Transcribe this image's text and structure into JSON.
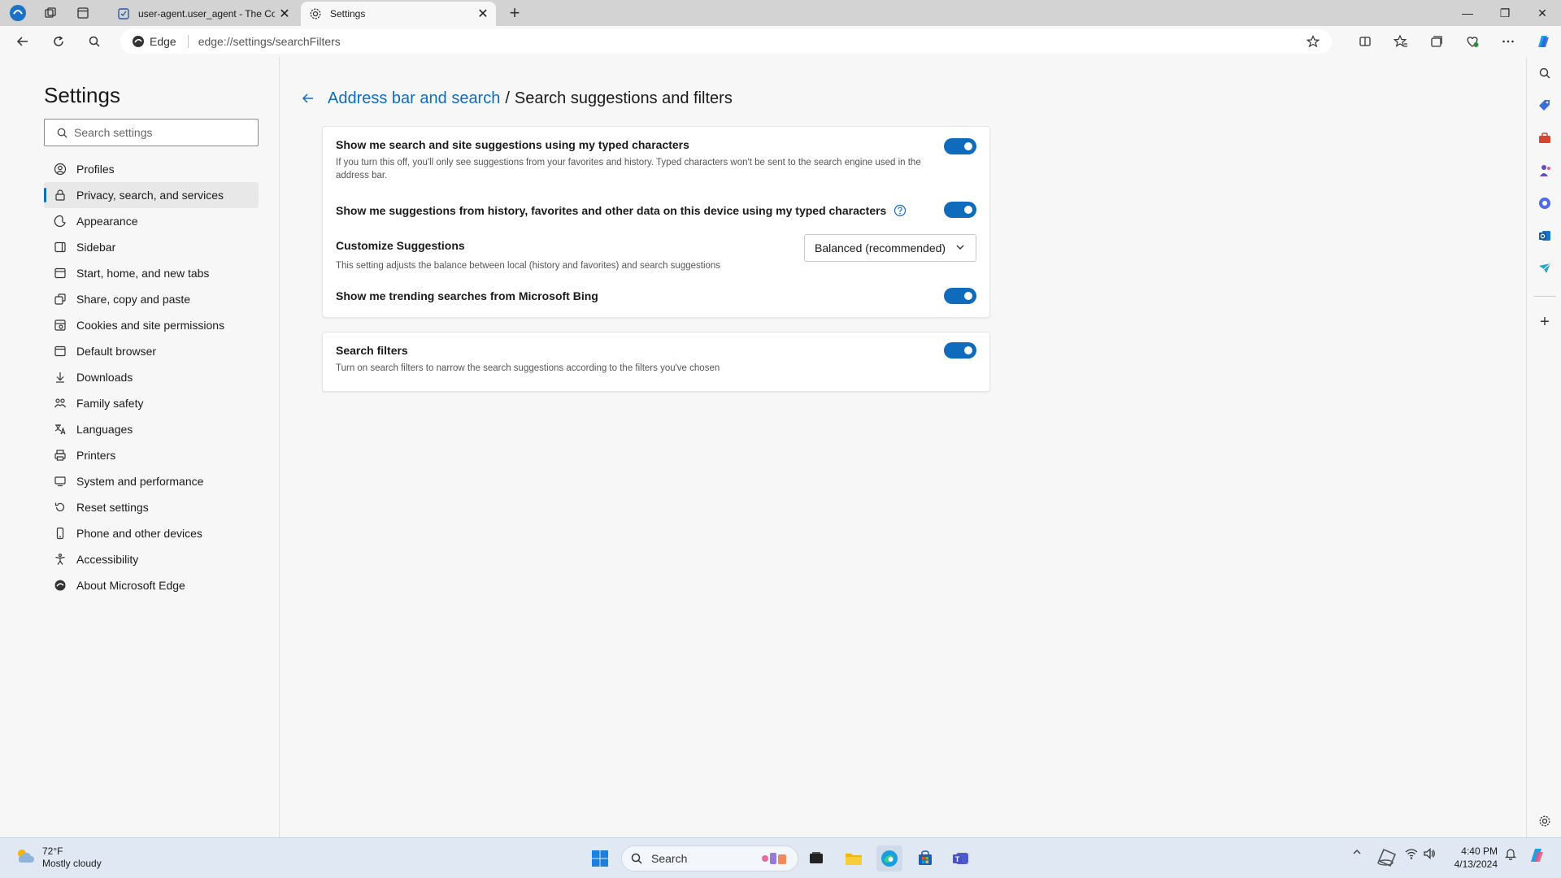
{
  "browser": {
    "tabs": [
      {
        "title": "user-agent.user_agent - The Coll"
      },
      {
        "title": "Settings"
      }
    ],
    "omnibox": {
      "site_label": "Edge",
      "url": "edge://settings/searchFilters"
    }
  },
  "sidebar": {
    "title": "Settings",
    "search_placeholder": "Search settings",
    "items": [
      {
        "label": "Profiles",
        "icon": "profile-icon"
      },
      {
        "label": "Privacy, search, and services",
        "icon": "lock-icon",
        "active": true
      },
      {
        "label": "Appearance",
        "icon": "appearance-icon"
      },
      {
        "label": "Sidebar",
        "icon": "sidebar-icon"
      },
      {
        "label": "Start, home, and new tabs",
        "icon": "home-icon"
      },
      {
        "label": "Share, copy and paste",
        "icon": "share-icon"
      },
      {
        "label": "Cookies and site permissions",
        "icon": "cookies-icon"
      },
      {
        "label": "Default browser",
        "icon": "browser-icon"
      },
      {
        "label": "Downloads",
        "icon": "download-icon"
      },
      {
        "label": "Family safety",
        "icon": "family-icon"
      },
      {
        "label": "Languages",
        "icon": "language-icon"
      },
      {
        "label": "Printers",
        "icon": "printer-icon"
      },
      {
        "label": "System and performance",
        "icon": "system-icon"
      },
      {
        "label": "Reset settings",
        "icon": "reset-icon"
      },
      {
        "label": "Phone and other devices",
        "icon": "phone-icon"
      },
      {
        "label": "Accessibility",
        "icon": "accessibility-icon"
      },
      {
        "label": "About Microsoft Edge",
        "icon": "edge-icon"
      }
    ]
  },
  "main": {
    "breadcrumb_parent": "Address bar and search",
    "breadcrumb_separator": "/",
    "breadcrumb_current": "Search suggestions and filters",
    "settings": {
      "typed_suggestions": {
        "title": "Show me search and site suggestions using my typed characters",
        "description": "If you turn this off, you'll only see suggestions from your favorites and history. Typed characters won't be sent to the search engine used in the address bar.",
        "enabled": true
      },
      "history_suggestions": {
        "title": "Show me suggestions from history, favorites and other data on this device using my typed characters",
        "enabled": true
      },
      "customize": {
        "title": "Customize Suggestions",
        "description": "This setting adjusts the balance between local (history and favorites) and search suggestions",
        "selected": "Balanced (recommended)"
      },
      "trending": {
        "title": "Show me trending searches from Microsoft Bing",
        "enabled": true
      },
      "search_filters": {
        "title": "Search filters",
        "description": "Turn on search filters to narrow the search suggestions according to the filters you've chosen",
        "enabled": true
      }
    }
  },
  "taskbar": {
    "weather_temp": "72°F",
    "weather_desc": "Mostly cloudy",
    "search_label": "Search",
    "time": "4:40 PM",
    "date": "4/13/2024"
  },
  "colors": {
    "accent": "#0f6cbd",
    "toggle_on": "#0f6cbd"
  }
}
